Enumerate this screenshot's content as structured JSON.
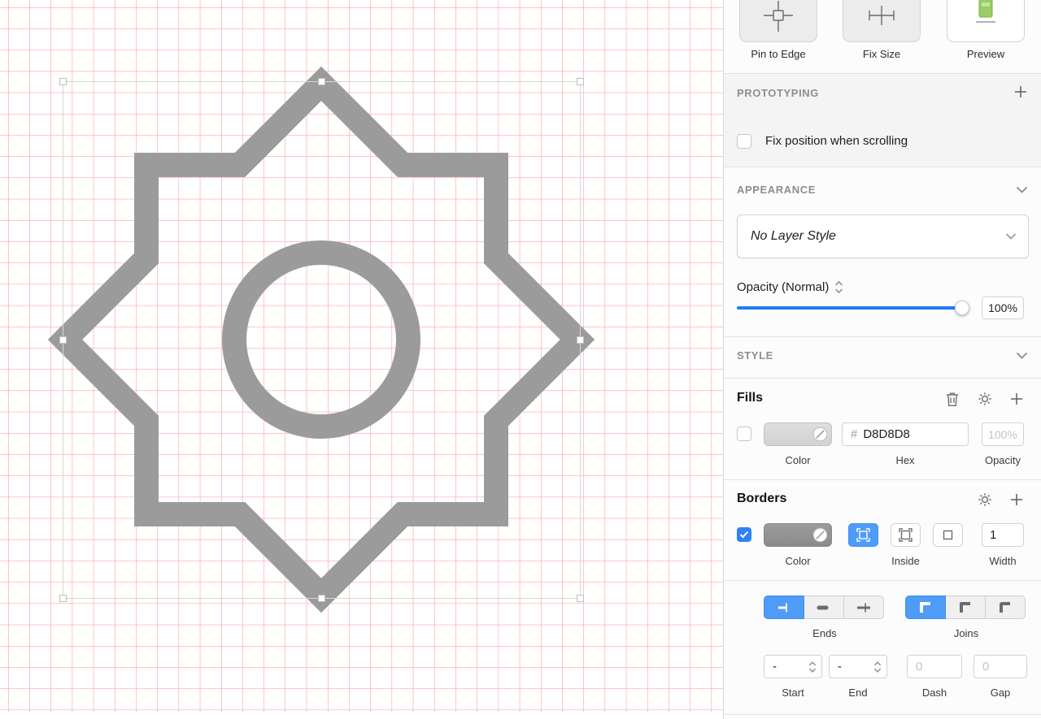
{
  "colors": {
    "accent_blue": "#1f7cf5",
    "selected_segment_blue": "#4f9cf8",
    "shape_gray": "#9b9b9b",
    "grid_red": "#ff5252",
    "fill_swatch_hex": "#D8D8D8",
    "border_swatch": "#929292"
  },
  "inspector": {
    "resizing": {
      "actions": [
        {
          "label": "Pin to Edge"
        },
        {
          "label": "Fix Size"
        },
        {
          "label": "Preview"
        }
      ]
    },
    "prototyping": {
      "title": "PROTOTYPING",
      "checkbox_label": "Fix position when scrolling"
    },
    "appearance": {
      "title": "APPEARANCE",
      "layer_style": "No Layer Style",
      "opacity_label": "Opacity (Normal)",
      "opacity_value": "100%"
    },
    "style": {
      "title": "STYLE"
    },
    "fills": {
      "title": "Fills",
      "hex_prefix": "#",
      "hex_value": "D8D8D8",
      "opacity_value": "100%",
      "col_color": "Color",
      "col_hex": "Hex",
      "col_opacity": "Opacity"
    },
    "borders": {
      "title": "Borders",
      "width_value": "1",
      "col_color": "Color",
      "col_position": "Inside",
      "col_width": "Width"
    },
    "stroke": {
      "ends_label": "Ends",
      "joins_label": "Joins",
      "start_value": "-",
      "end_value": "-",
      "dash_value": "0",
      "gap_value": "0",
      "col_start": "Start",
      "col_end": "End",
      "col_dash": "Dash",
      "col_gap": "Gap"
    }
  }
}
